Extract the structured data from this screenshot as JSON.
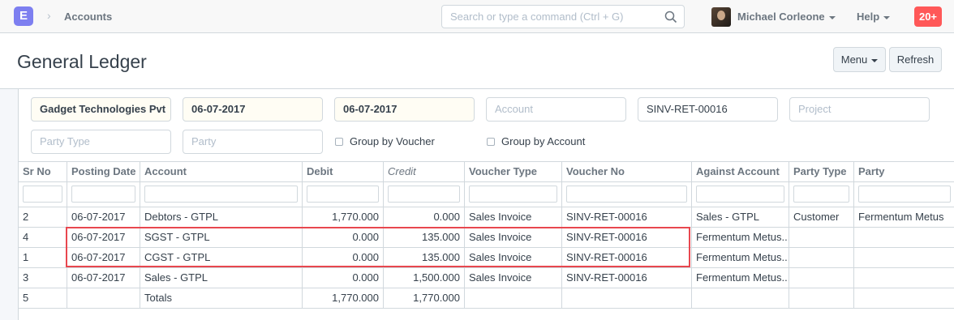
{
  "navbar": {
    "logo": "E",
    "breadcrumb": "Accounts",
    "search_placeholder": "Search or type a command (Ctrl + G)",
    "user_name": "Michael Corleone",
    "help_label": "Help",
    "notifications": "20+"
  },
  "page": {
    "title": "General Ledger",
    "menu_label": "Menu",
    "refresh_label": "Refresh"
  },
  "filters": {
    "company": "Gadget Technologies Pvt",
    "from_date": "06-07-2017",
    "to_date": "06-07-2017",
    "account_placeholder": "Account",
    "voucher_no": "SINV-RET-00016",
    "project_placeholder": "Project",
    "party_type_placeholder": "Party Type",
    "party_placeholder": "Party",
    "group_by_voucher": "Group by Voucher",
    "group_by_account": "Group by Account"
  },
  "table": {
    "columns": [
      "Sr No",
      "Posting Date",
      "Account",
      "Debit",
      "Credit",
      "Voucher Type",
      "Voucher No",
      "Against Account",
      "Party Type",
      "Party"
    ],
    "rows": [
      [
        "2",
        "06-07-2017",
        "Debtors - GTPL",
        "1,770.000",
        "0.000",
        "Sales Invoice",
        "SINV-RET-00016",
        "Sales - GTPL",
        "Customer",
        "Fermentum Metus"
      ],
      [
        "4",
        "06-07-2017",
        "SGST - GTPL",
        "0.000",
        "135.000",
        "Sales Invoice",
        "SINV-RET-00016",
        "Fermentum Metus...",
        "",
        ""
      ],
      [
        "1",
        "06-07-2017",
        "CGST - GTPL",
        "0.000",
        "135.000",
        "Sales Invoice",
        "SINV-RET-00016",
        "Fermentum Metus...",
        "",
        ""
      ],
      [
        "3",
        "06-07-2017",
        "Sales - GTPL",
        "0.000",
        "1,500.000",
        "Sales Invoice",
        "SINV-RET-00016",
        "Fermentum Metus...",
        "",
        ""
      ],
      [
        "5",
        "",
        "Totals",
        "1,770.000",
        "1,770.000",
        "",
        "",
        "",
        "",
        ""
      ]
    ]
  },
  "colors": {
    "accent": "#7d7ff0",
    "notification": "#ff5858",
    "highlight": "#e8474f"
  }
}
